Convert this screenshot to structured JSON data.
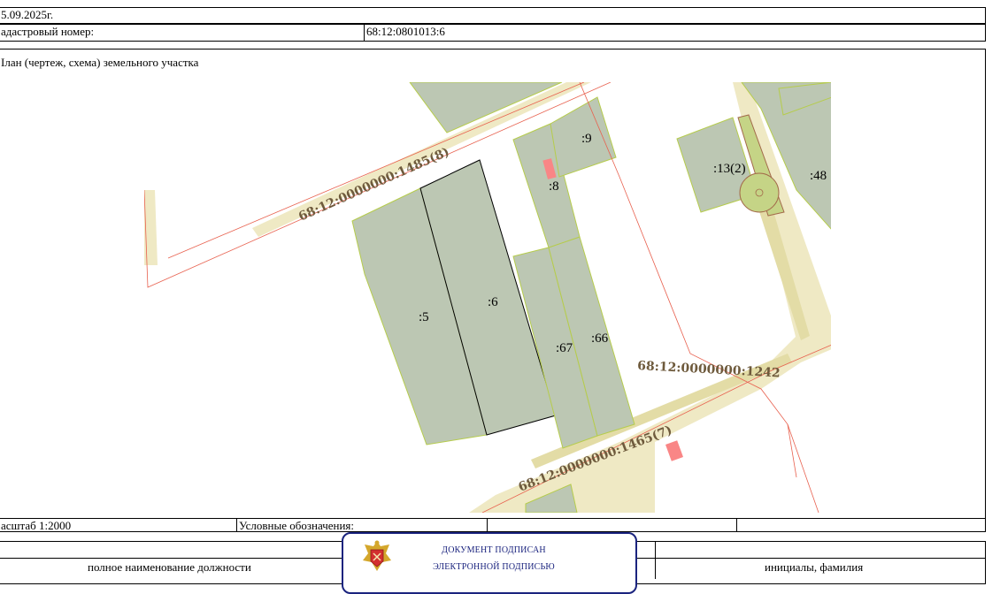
{
  "header": {
    "date": "5.09.2025г.",
    "cadastral_label": "адастровый номер:",
    "cadastral_value": "68:12:0801013:6",
    "plan_title": "Ілан (чертеж, схема) земельного участка"
  },
  "map": {
    "parcel_labels": [
      ":5",
      ":6",
      ":67",
      ":66",
      ":8",
      ":9",
      ":13(2)",
      ":48"
    ],
    "road_labels": [
      "68:12:0000000:1485(8)",
      "68:12:0000000:1242",
      "68:12:0000000:1465(7)"
    ],
    "colors": {
      "parcel_fill": "#bcc7b3",
      "parcel_stroke": "#b6cc4c",
      "road_fill": "#efe9c4",
      "boundary_red": "#e8614f",
      "building": "#f98686",
      "road_label": "#6e5a3c",
      "selected_fill": "#c5d486"
    }
  },
  "footer": {
    "scale": "асштаб 1:2000",
    "legend": "Условные обозначения:",
    "position_label": "полное наименование должности",
    "name_label": "инициалы, фамилия"
  },
  "stamp": {
    "line1": "ДОКУМЕНТ ПОДПИСАН",
    "line2": "ЭЛЕКТРОННОЙ ПОДПИСЬЮ",
    "emblem": "emblem-icon"
  }
}
